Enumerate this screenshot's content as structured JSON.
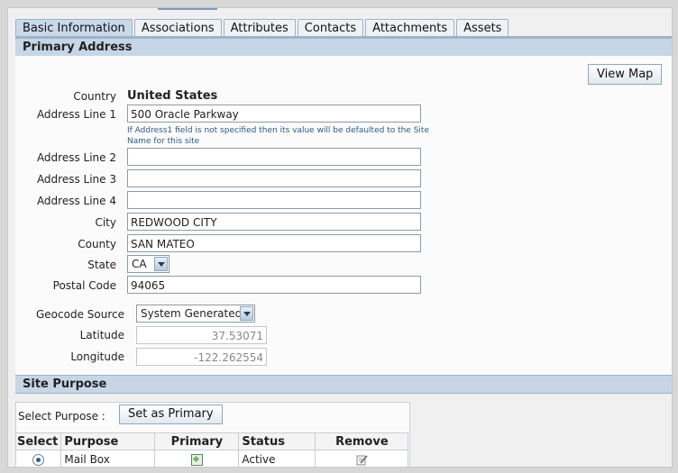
{
  "tabs": [
    "Basic Information",
    "Associations",
    "Attributes",
    "Contacts",
    "Attachments",
    "Assets"
  ],
  "active_tab": "Basic Information",
  "primary_address": {
    "header": "Primary Address",
    "view_map_label": "View Map",
    "country_label": "Country",
    "country_value": "United States",
    "address1_label": "Address Line 1",
    "address1_value": "500 Oracle Parkway",
    "address1_hint_line1": "If Address1 field is not specified then its value will be defaulted to the Site",
    "address1_hint_line2": "Name for this site",
    "address2_label": "Address Line 2",
    "address2_value": "",
    "address3_label": "Address Line 3",
    "address3_value": "",
    "address4_label": "Address Line 4",
    "address4_value": "",
    "city_label": "City",
    "city_value": "REDWOOD CITY",
    "county_label": "County",
    "county_value": "SAN MATEO",
    "state_label": "State",
    "state_value": "CA",
    "postal_label": "Postal Code",
    "postal_value": "94065",
    "geocode_label": "Geocode Source",
    "geocode_value": "System Generated",
    "latitude_label": "Latitude",
    "latitude_value": "37.53071",
    "longitude_label": "Longitude",
    "longitude_value": "-122.262554"
  },
  "site_purpose": {
    "header": "Site Purpose",
    "select_purpose_label": "Select Purpose :",
    "set_primary_label": "Set as Primary",
    "columns": [
      "Select",
      "Purpose",
      "Primary",
      "Status",
      "Remove"
    ],
    "rows": [
      {
        "purpose": "Mail Box",
        "status": "Active"
      }
    ]
  }
}
